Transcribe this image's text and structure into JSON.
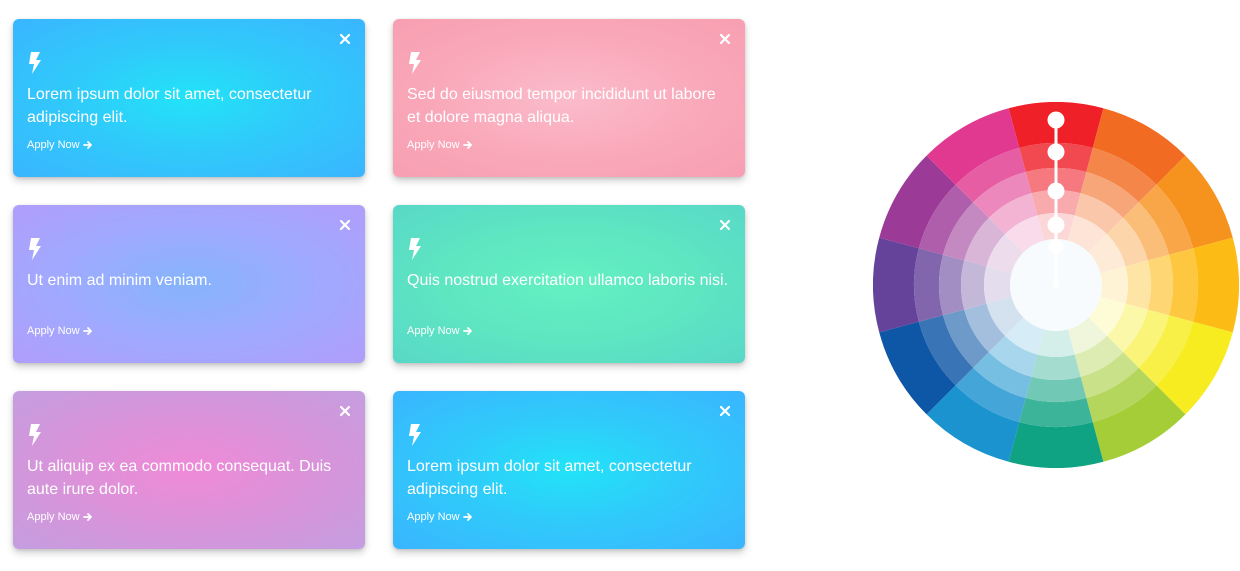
{
  "cards": [
    {
      "message": "Lorem ipsum dolor sit amet, consectetur adipiscing elit.",
      "action": "Apply Now",
      "color": "#2fcbfa"
    },
    {
      "message": "Sed do eiusmod tempor incididunt ut labore et dolore magna aliqua.",
      "action": "Apply Now",
      "color": "#f9a8b9"
    },
    {
      "message": "Ut enim ad minim veniam.",
      "action": "Apply Now",
      "color": "#9faaff"
    },
    {
      "message": "Quis nostrud exercitation ullamco laboris nisi.",
      "action": "Apply Now",
      "color": "#5ee6c1"
    },
    {
      "message": "Ut aliquip ex ea commodo consequat. Duis aute irure dolor.",
      "action": "Apply Now",
      "color": "#d993d9"
    },
    {
      "message": "Lorem ipsum dolor sit amet, consectetur adipiscing elit.",
      "action": "Apply Now",
      "color": "#2fcbfa"
    }
  ],
  "icons": {
    "card_icon": "bolt-icon",
    "close": "close-icon",
    "action_arrow": "arrow-right-icon"
  },
  "color_wheel": {
    "hues": [
      "#ef2028",
      "#f26b22",
      "#f6921e",
      "#fdbb16",
      "#f6ec1f",
      "#a5cd38",
      "#10a383",
      "#1b93cf",
      "#0e56a6",
      "#65439b",
      "#9c3b97",
      "#e0398f"
    ],
    "selected_hue": "#ef2028"
  }
}
